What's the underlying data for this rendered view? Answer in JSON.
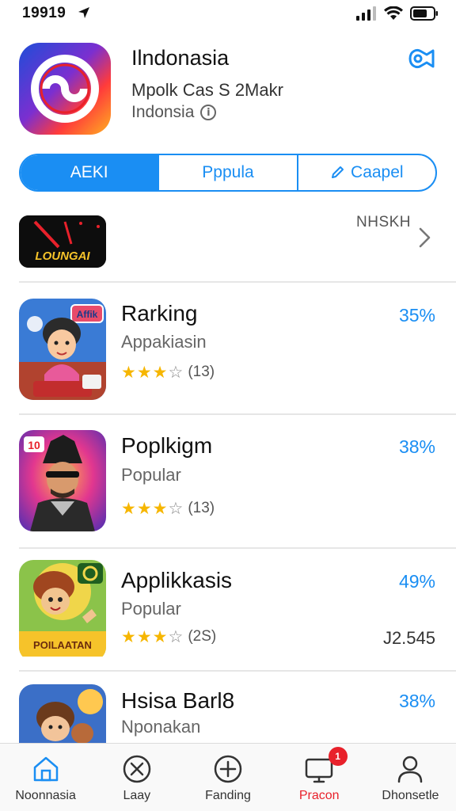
{
  "status_bar": {
    "time": "19919"
  },
  "header": {
    "title": "Ilndonasia",
    "subtitle": "Mpolk Cas S 2Makr",
    "region": "Indonsia",
    "info_icon": "i"
  },
  "segments": [
    {
      "label": "AEKI",
      "selected": true
    },
    {
      "label": "Pppula",
      "selected": false
    },
    {
      "label": "Caapel",
      "selected": false,
      "icon": "pencil-icon"
    }
  ],
  "banner": {
    "thumb_text": "LOUNGAI",
    "link_text": "NHSKH"
  },
  "rows": [
    {
      "title": "Rarking",
      "subtitle": "Appakiasin",
      "rating": "(13)",
      "stars": 3.5,
      "percent": "35%",
      "badge_text": "Affik",
      "extra": ""
    },
    {
      "title": "Poplkigm",
      "subtitle": "Popular",
      "rating": "(13)",
      "stars": 3.5,
      "percent": "38%",
      "badge_text": "10",
      "extra": ""
    },
    {
      "title": "Applikkasis",
      "subtitle": "Popular",
      "rating": "(2S)",
      "stars": 3.5,
      "percent": "49%",
      "badge_text": "POILAATAN",
      "extra": "J2.545"
    },
    {
      "title": "Hsisa Barl8",
      "subtitle": "Nponakan",
      "rating": "",
      "stars": 0,
      "percent": "38%",
      "badge_text": "",
      "extra": ""
    }
  ],
  "tabbar": [
    {
      "label": "Noonnasia",
      "icon": "home-icon"
    },
    {
      "label": "Laay",
      "icon": "compass-icon"
    },
    {
      "label": "Fanding",
      "icon": "plus-circle-icon"
    },
    {
      "label": "Pracon",
      "icon": "monitor-icon",
      "badge": "1"
    },
    {
      "label": "Dhonsetle",
      "icon": "person-icon"
    }
  ],
  "colors": {
    "accent": "#1a8ef3",
    "star": "#f6b600",
    "badge": "#e8212b"
  }
}
